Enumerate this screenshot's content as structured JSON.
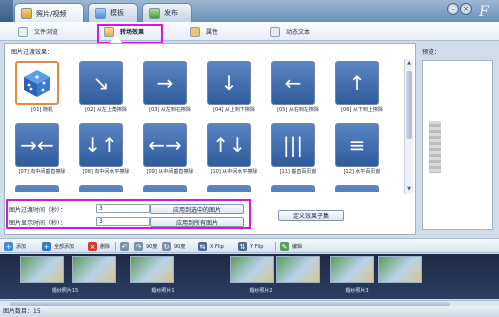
{
  "tabs": [
    {
      "label": "照片/视频",
      "icon": "photo-video-icon",
      "active": true
    },
    {
      "label": "模板",
      "icon": "template-icon",
      "active": false
    },
    {
      "label": "发布",
      "icon": "publish-icon",
      "active": false
    }
  ],
  "subtabs": [
    {
      "label": "文件浏览",
      "icon": "file-browse-icon",
      "active": false
    },
    {
      "label": "转场效果",
      "icon": "transition-icon",
      "active": true
    },
    {
      "label": "属性",
      "icon": "properties-icon",
      "active": false
    },
    {
      "label": "动态文本",
      "icon": "dynamic-text-icon",
      "active": false
    }
  ],
  "section": {
    "label": "图片过渡效果："
  },
  "transitions": [
    {
      "label": "[01] 随机",
      "glyph": "dice"
    },
    {
      "label": "[02] 从左上角擦除",
      "glyph": "↘"
    },
    {
      "label": "[03] 从左到右擦除",
      "glyph": "→"
    },
    {
      "label": "[04] 从上到下擦除",
      "glyph": "↓"
    },
    {
      "label": "[05] 从右到左擦除",
      "glyph": "←"
    },
    {
      "label": "[06] 从下到上擦除",
      "glyph": "↑"
    },
    {
      "label": "[07] 向中间垂直擦除",
      "glyph": "→←"
    },
    {
      "label": "[08] 向中间水平擦除",
      "glyph": "↓↑"
    },
    {
      "label": "[09] 从中间垂直擦除",
      "glyph": "←→"
    },
    {
      "label": "[10] 从中间水平擦除",
      "glyph": "↑↓"
    },
    {
      "label": "[11] 垂直百页窗",
      "glyph": "|||"
    },
    {
      "label": "[12] 水平百页窗",
      "glyph": "≡"
    },
    {
      "label": "",
      "glyph": "↓↑"
    },
    {
      "label": "",
      "glyph": "✦"
    },
    {
      "label": "",
      "glyph": "⇄"
    },
    {
      "label": "",
      "glyph": "▦"
    },
    {
      "label": "",
      "glyph": "▥"
    },
    {
      "label": "",
      "glyph": "▤"
    }
  ],
  "timing": {
    "transition_label": "图片过渡时间（秒）：",
    "transition_value": "3",
    "display_label": "图片显示时间（秒）：",
    "display_value": "3",
    "apply_selected": "应用到选中的图片",
    "apply_all": "应用到所有图片",
    "define_subset": "定义效果子集"
  },
  "preview": {
    "label": "预览："
  },
  "toolbar": [
    {
      "label": "添加",
      "icon": "add-icon"
    },
    {
      "label": "全部添加",
      "icon": "add-all-icon"
    },
    {
      "label": "删除",
      "icon": "delete-icon"
    },
    {
      "label": "",
      "icon": "rotate-ccw-icon"
    },
    {
      "label": "90度",
      "icon": "rotate-90-icon"
    },
    {
      "label": "90度",
      "icon": "rotate-90-cw-icon"
    },
    {
      "label": "X Flip",
      "icon": "x-flip-icon"
    },
    {
      "label": "Y Flip",
      "icon": "y-flip-icon"
    },
    {
      "label": "编辑",
      "icon": "edit-icon"
    }
  ],
  "filmstrip": [
    {
      "label": "婚纱照片15"
    },
    {
      "label": "婚纱照片1"
    },
    {
      "label": "婚纱照片2"
    },
    {
      "label": "婚纱照片3"
    }
  ],
  "status": {
    "text": "图片数目：15"
  },
  "colors": {
    "highlight": "#d219d8",
    "selected_frame": "#e38a3c",
    "thumb_blue": "#2f5a9c"
  }
}
